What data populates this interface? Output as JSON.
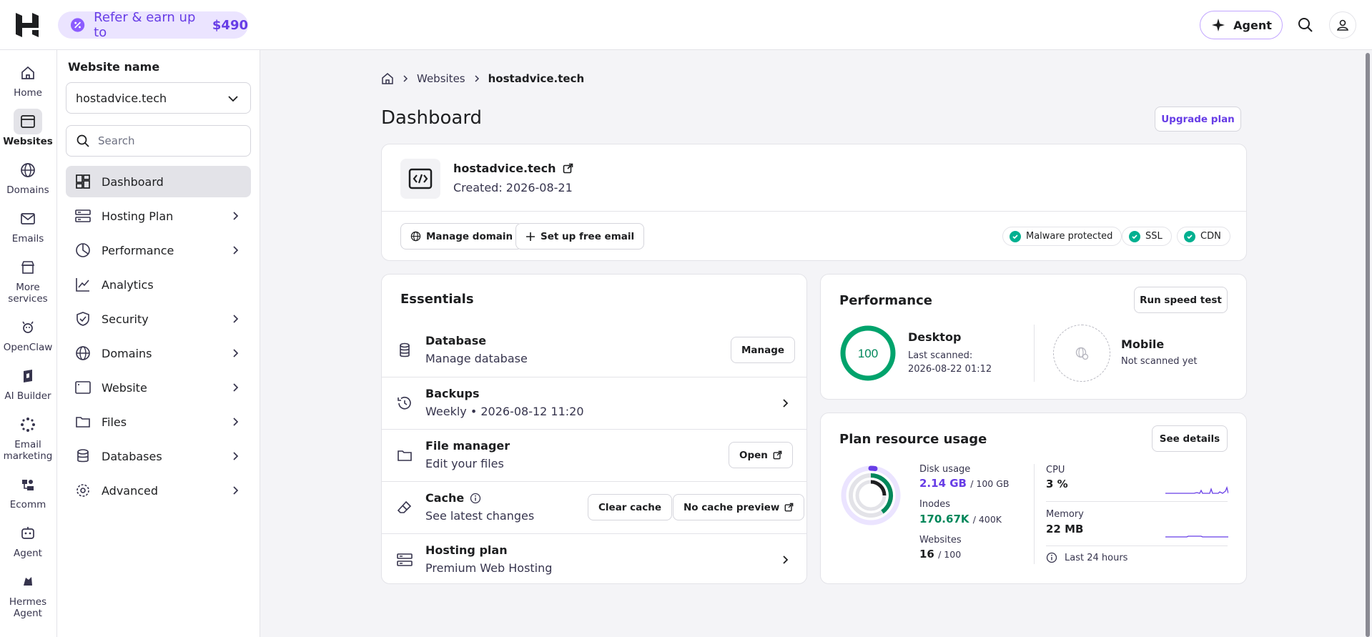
{
  "topbar": {
    "refer_text": "Refer & earn up to",
    "refer_amount": "$490",
    "agent_label": "Agent"
  },
  "rail": {
    "items": [
      {
        "label": "Home",
        "icon": "home-icon"
      },
      {
        "label": "Websites",
        "icon": "browser-icon"
      },
      {
        "label": "Domains",
        "icon": "globe-icon"
      },
      {
        "label": "Emails",
        "icon": "mail-icon"
      },
      {
        "label": "More services",
        "icon": "store-icon"
      },
      {
        "label": "OpenClaw",
        "icon": "claw-icon"
      },
      {
        "label": "AI Builder",
        "icon": "ai-builder-icon"
      },
      {
        "label": "Email marketing",
        "icon": "email-marketing-icon"
      },
      {
        "label": "Ecomm",
        "icon": "ecomm-icon"
      },
      {
        "label": "Agent",
        "icon": "agent-icon"
      },
      {
        "label": "Hermes Agent",
        "icon": "hermes-icon"
      }
    ]
  },
  "sidebar": {
    "title": "Website name",
    "selected_site": "hostadvice.tech",
    "search_placeholder": "Search",
    "items": [
      {
        "label": "Dashboard"
      },
      {
        "label": "Hosting Plan"
      },
      {
        "label": "Performance"
      },
      {
        "label": "Analytics"
      },
      {
        "label": "Security"
      },
      {
        "label": "Domains"
      },
      {
        "label": "Website"
      },
      {
        "label": "Files"
      },
      {
        "label": "Databases"
      },
      {
        "label": "Advanced"
      }
    ]
  },
  "breadcrumb": {
    "items": [
      "Websites",
      "hostadvice.tech"
    ]
  },
  "main": {
    "title": "Dashboard",
    "upgrade_label": "Upgrade plan"
  },
  "site_card": {
    "name": "hostadvice.tech",
    "created": "Created: 2026-08-21",
    "manage_domain": "Manage domain",
    "setup_email": "Set up free email",
    "badges": [
      "Malware protected",
      "SSL",
      "CDN"
    ]
  },
  "essentials": {
    "title": "Essentials",
    "rows": [
      {
        "title": "Database",
        "subtitle": "Manage database",
        "action": "Manage"
      },
      {
        "title": "Backups",
        "subtitle": "Weekly • 2026-08-12 11:20"
      },
      {
        "title": "File manager",
        "subtitle": "Edit your files",
        "action": "Open"
      },
      {
        "title": "Cache",
        "subtitle": "See latest changes",
        "action": "Clear cache",
        "action2": "No cache preview"
      },
      {
        "title": "Hosting plan",
        "subtitle": "Premium Web Hosting"
      }
    ]
  },
  "performance": {
    "title": "Performance",
    "run_label": "Run speed test",
    "desktop_score": "100",
    "desktop_score_value": 100,
    "desktop_label": "Desktop",
    "desktop_meta1": "Last scanned:",
    "desktop_meta2": "2026-08-22 01:12",
    "mobile_label": "Mobile",
    "mobile_status": "Not scanned yet"
  },
  "plan_usage": {
    "title": "Plan resource usage",
    "details_label": "See details",
    "disk_label": "Disk usage",
    "disk_value": "2.14 GB",
    "disk_total": "/ 100 GB",
    "inodes_label": "Inodes",
    "inodes_value": "170.67K",
    "inodes_total": "/ 400K",
    "websites_label": "Websites",
    "websites_value": "16",
    "websites_total": "/ 100",
    "cpu_label": "CPU",
    "cpu_value": "3 %",
    "memory_label": "Memory",
    "memory_value": "22 MB",
    "period": "Last 24 hours"
  },
  "colors": {
    "brand": "#673de6",
    "success": "#00b090"
  }
}
